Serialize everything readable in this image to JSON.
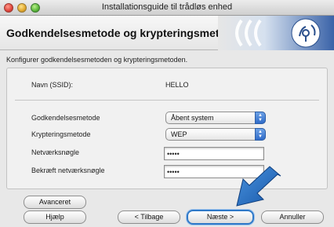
{
  "window": {
    "title": "Installationsguide til trådløs enhed"
  },
  "header": {
    "title": "Godkendelsesmetode og krypteringsmetode"
  },
  "subtitle": "Konfigurer godkendelsesmetoden og krypteringsmetoden.",
  "form": {
    "ssid_label": "Navn (SSID):",
    "ssid_value": "HELLO",
    "auth_label": "Godkendelsesmetode",
    "auth_value": "Åbent system",
    "enc_label": "Krypteringsmetode",
    "enc_value": "WEP",
    "key_label": "Netværksnøgle",
    "key_value": "•••••",
    "confirm_label": "Bekræft netværksnøgle",
    "confirm_value": "•••••"
  },
  "buttons": {
    "advanced": "Avanceret",
    "help": "Hjælp",
    "back": "< Tilbage",
    "next": "Næste >",
    "cancel": "Annuller"
  },
  "colors": {
    "accent": "#2f79c8",
    "pointer_arrow": "#1f6fc4"
  },
  "icons": {
    "logo": "wireless-signal-icon",
    "select_arrows": "updown-arrows-icon",
    "pointer": "pointer-arrow-icon"
  }
}
